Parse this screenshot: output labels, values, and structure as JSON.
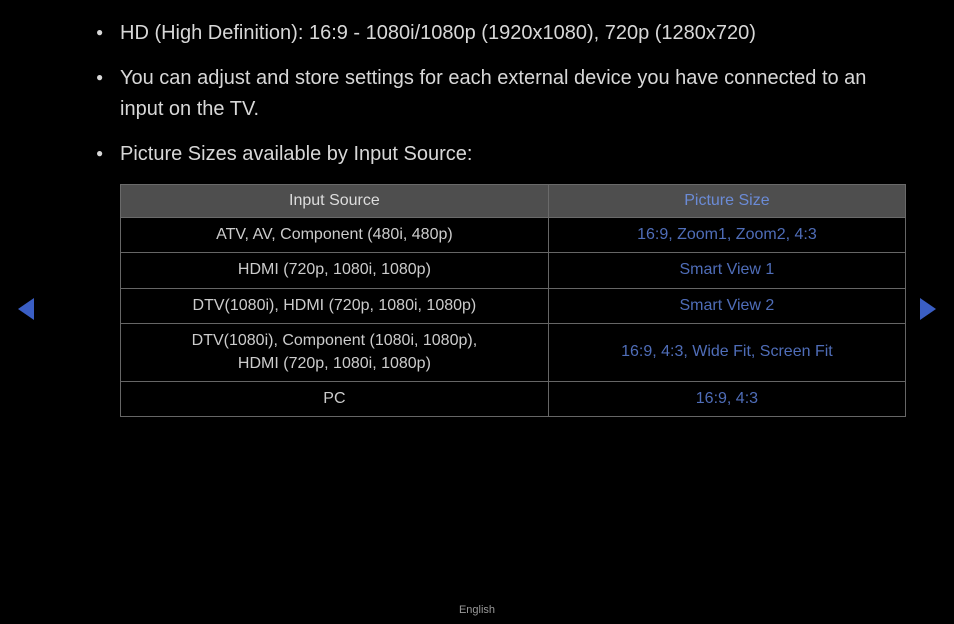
{
  "bullets": [
    "HD (High Definition): 16:9 - 1080i/1080p (1920x1080), 720p (1280x720)",
    "You can adjust and store settings for each external device you have connected to an input on the TV.",
    "Picture Sizes available by Input Source:"
  ],
  "table": {
    "headers": {
      "source": "Input Source",
      "size": "Picture Size"
    },
    "rows": [
      {
        "source": "ATV, AV, Component (480i, 480p)",
        "size": "16:9, Zoom1, Zoom2, 4:3"
      },
      {
        "source": "HDMI (720p, 1080i, 1080p)",
        "size": "Smart View 1"
      },
      {
        "source": "DTV(1080i), HDMI (720p, 1080i, 1080p)",
        "size": "Smart View 2"
      },
      {
        "source": "DTV(1080i), Component (1080i, 1080p),\nHDMI (720p, 1080i, 1080p)",
        "size": "16:9, 4:3, Wide Fit, Screen Fit"
      },
      {
        "source": "PC",
        "size": "16:9, 4:3"
      }
    ]
  },
  "footer": {
    "language": "English"
  }
}
